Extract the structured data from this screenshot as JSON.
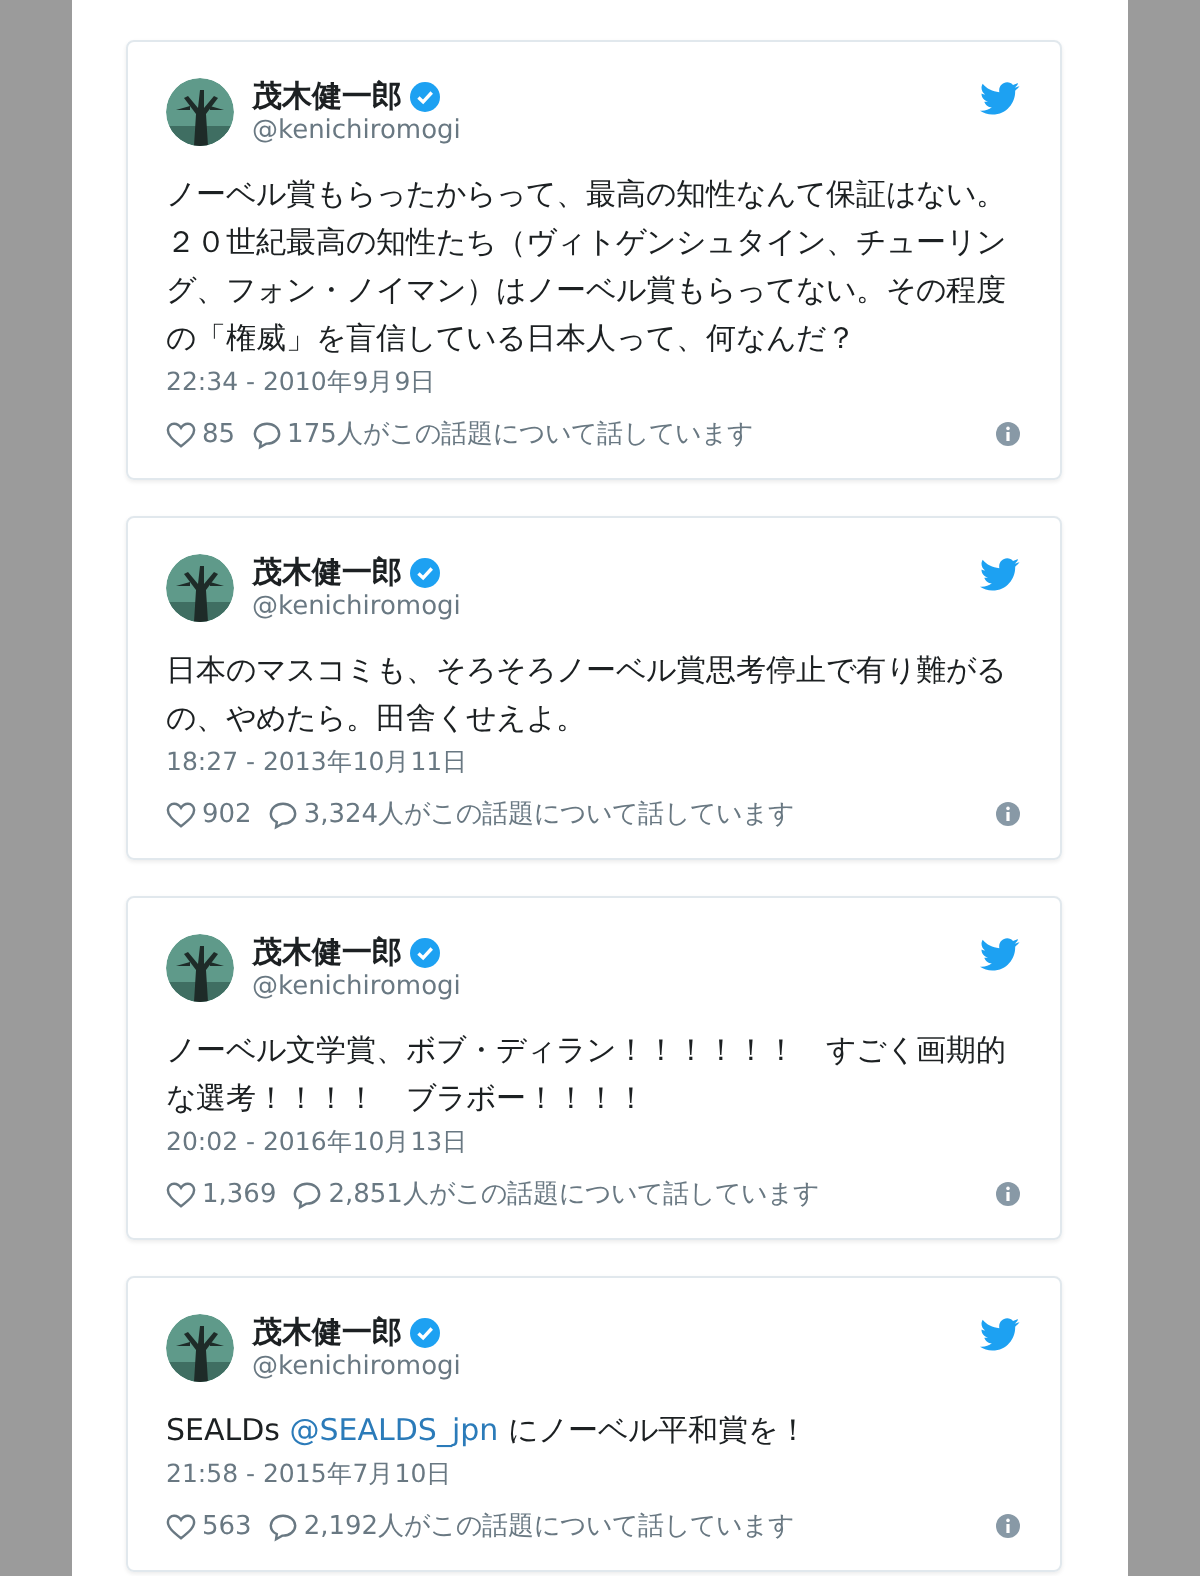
{
  "tweets": [
    {
      "name": "茂木健一郎",
      "verified": true,
      "handle": "@kenichiromogi",
      "text": [
        {
          "kind": "text",
          "text": "ノーベル賞もらったからって、最高の知性なんて保証はない。２０世紀最高の知性たち（ヴィトゲンシュタイン、チューリング、フォン・ノイマン）はノーベル賞もらってない。その程度の「権威」を盲信している日本人って、何なんだ？"
        }
      ],
      "time": "22:34 - 2010年9月9日",
      "likes": "85",
      "talking": "175人がこの話題について話しています"
    },
    {
      "name": "茂木健一郎",
      "verified": true,
      "handle": "@kenichiromogi",
      "text": [
        {
          "kind": "text",
          "text": "日本のマスコミも、そろそろノーベル賞思考停止で有り難がるの、やめたら。田舎くせえよ。"
        }
      ],
      "time": "18:27 - 2013年10月11日",
      "likes": "902",
      "talking": "3,324人がこの話題について話しています"
    },
    {
      "name": "茂木健一郎",
      "verified": true,
      "handle": "@kenichiromogi",
      "text": [
        {
          "kind": "text",
          "text": "ノーベル文学賞、ボブ・ディラン！！！！！！　すごく画期的な選考！！！！　ブラボー！！！！"
        }
      ],
      "time": "20:02 - 2016年10月13日",
      "likes": "1,369",
      "talking": "2,851人がこの話題について話しています"
    },
    {
      "name": "茂木健一郎",
      "verified": true,
      "handle": "@kenichiromogi",
      "text": [
        {
          "kind": "text",
          "text": "SEALDs "
        },
        {
          "kind": "mention",
          "text": "@SEALDS_jpn"
        },
        {
          "kind": "text",
          "text": " にノーベル平和賞を！"
        }
      ],
      "time": "21:58 - 2015年7月10日",
      "likes": "563",
      "talking": "2,192人がこの話題について話しています"
    }
  ]
}
